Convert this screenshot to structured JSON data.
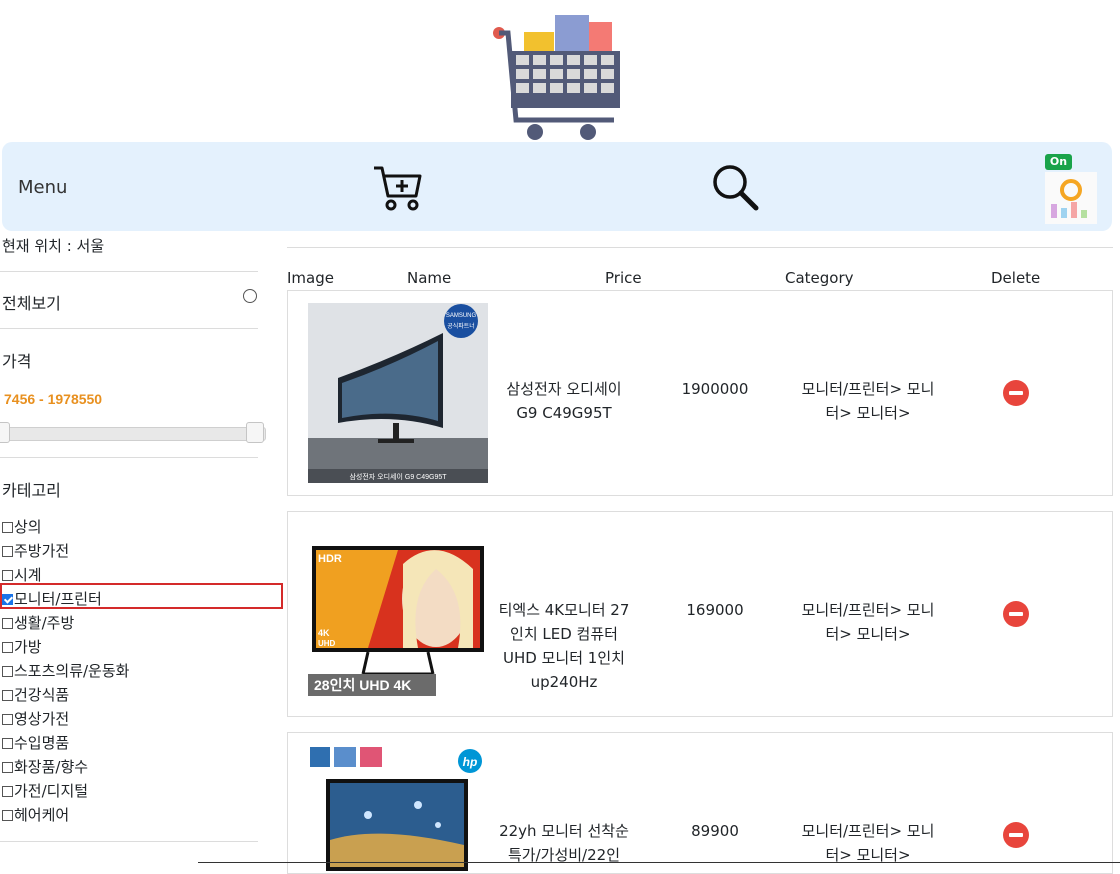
{
  "navbar": {
    "menu_label": "Menu",
    "cart_icon": "cart-plus-icon",
    "search_icon": "search-icon",
    "badge": "On"
  },
  "sidebar": {
    "location": "현재 위치 : 서울",
    "view_all": "전체보기",
    "price_label": "가격",
    "price_range": "7456 - 1978550",
    "price_slider": {
      "min": 7456,
      "max": 1978550
    },
    "category_label": "카테고리",
    "categories": [
      {
        "label": "상의",
        "checked": false
      },
      {
        "label": "주방가전",
        "checked": false
      },
      {
        "label": "시계",
        "checked": false
      },
      {
        "label": "모니터/프린터",
        "checked": true
      },
      {
        "label": "생활/주방",
        "checked": false
      },
      {
        "label": "가방",
        "checked": false
      },
      {
        "label": "스포츠의류/운동화",
        "checked": false
      },
      {
        "label": "건강식품",
        "checked": false
      },
      {
        "label": "영상가전",
        "checked": false
      },
      {
        "label": "수입명품",
        "checked": false
      },
      {
        "label": "화장품/향수",
        "checked": false
      },
      {
        "label": "가전/디지털",
        "checked": false
      },
      {
        "label": "헤어케어",
        "checked": false
      }
    ]
  },
  "table": {
    "headers": [
      "Image",
      "Name",
      "Price",
      "Category",
      "Delete"
    ],
    "rows": [
      {
        "name_lines": [
          "삼성전자 오디세이",
          "G9 C49G95T"
        ],
        "price": "1900000",
        "category_lines": [
          "모니터/프린터> 모니",
          "터> 모니터>"
        ],
        "thumb_texts": [
          "SAMSUNG",
          "공식파트너",
          "삼성전자 오디세이 G9 C49G95T"
        ]
      },
      {
        "name_lines": [
          "티엑스 4K모니터 27",
          "인치 LED 컴퓨터",
          "UHD 모니터 1인치",
          "up240Hz"
        ],
        "price": "169000",
        "category_lines": [
          "모니터/프린터> 모니",
          "터> 모니터>"
        ],
        "thumb_texts": [
          "HDR",
          "4K",
          "UHD",
          "28인치 UHD 4K"
        ]
      },
      {
        "name_lines": [
          "22yh 모니터 선착순",
          "특가/가성비/22인"
        ],
        "price": "89900",
        "category_lines": [
          "모니터/프린터> 모니",
          "터> 모니터>"
        ],
        "thumb_texts": [
          "hp"
        ]
      }
    ]
  },
  "colors": {
    "navbar_bg": "#e4f1fd",
    "price_range": "#e8901f",
    "delete": "#e8453c",
    "highlight": "#d42a2a"
  }
}
